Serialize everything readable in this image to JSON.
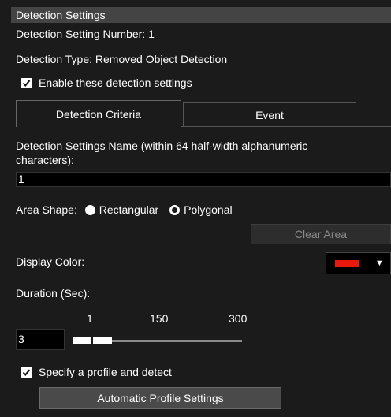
{
  "header": {
    "title": "Detection Settings"
  },
  "setting_number": "Detection Setting Number: 1",
  "detection_type": "Detection Type: Removed Object Detection",
  "enable": {
    "label": "Enable these detection settings",
    "checked": true
  },
  "tabs": [
    {
      "label": "Detection Criteria",
      "active": true
    },
    {
      "label": "Event",
      "active": false
    }
  ],
  "name_field": {
    "label_line1": "Detection Settings Name (within 64 half-width alphanumeric",
    "label_line2": "characters):",
    "value": "1"
  },
  "area_shape": {
    "label": "Area Shape:",
    "options": [
      {
        "label": "Rectangular",
        "selected": false
      },
      {
        "label": "Polygonal",
        "selected": true
      }
    ]
  },
  "clear_area": {
    "label": "Clear Area",
    "enabled": false
  },
  "display_color": {
    "label": "Display Color:",
    "value": "#e8180c"
  },
  "duration": {
    "label": "Duration (Sec):",
    "value": "3",
    "ticks": [
      "1",
      "150",
      "300"
    ],
    "min": 1,
    "max": 300,
    "slider_value": 3
  },
  "profile": {
    "label": "Specify a profile and detect",
    "checked": true
  },
  "auto_profile_button": {
    "label": "Automatic Profile Settings"
  }
}
